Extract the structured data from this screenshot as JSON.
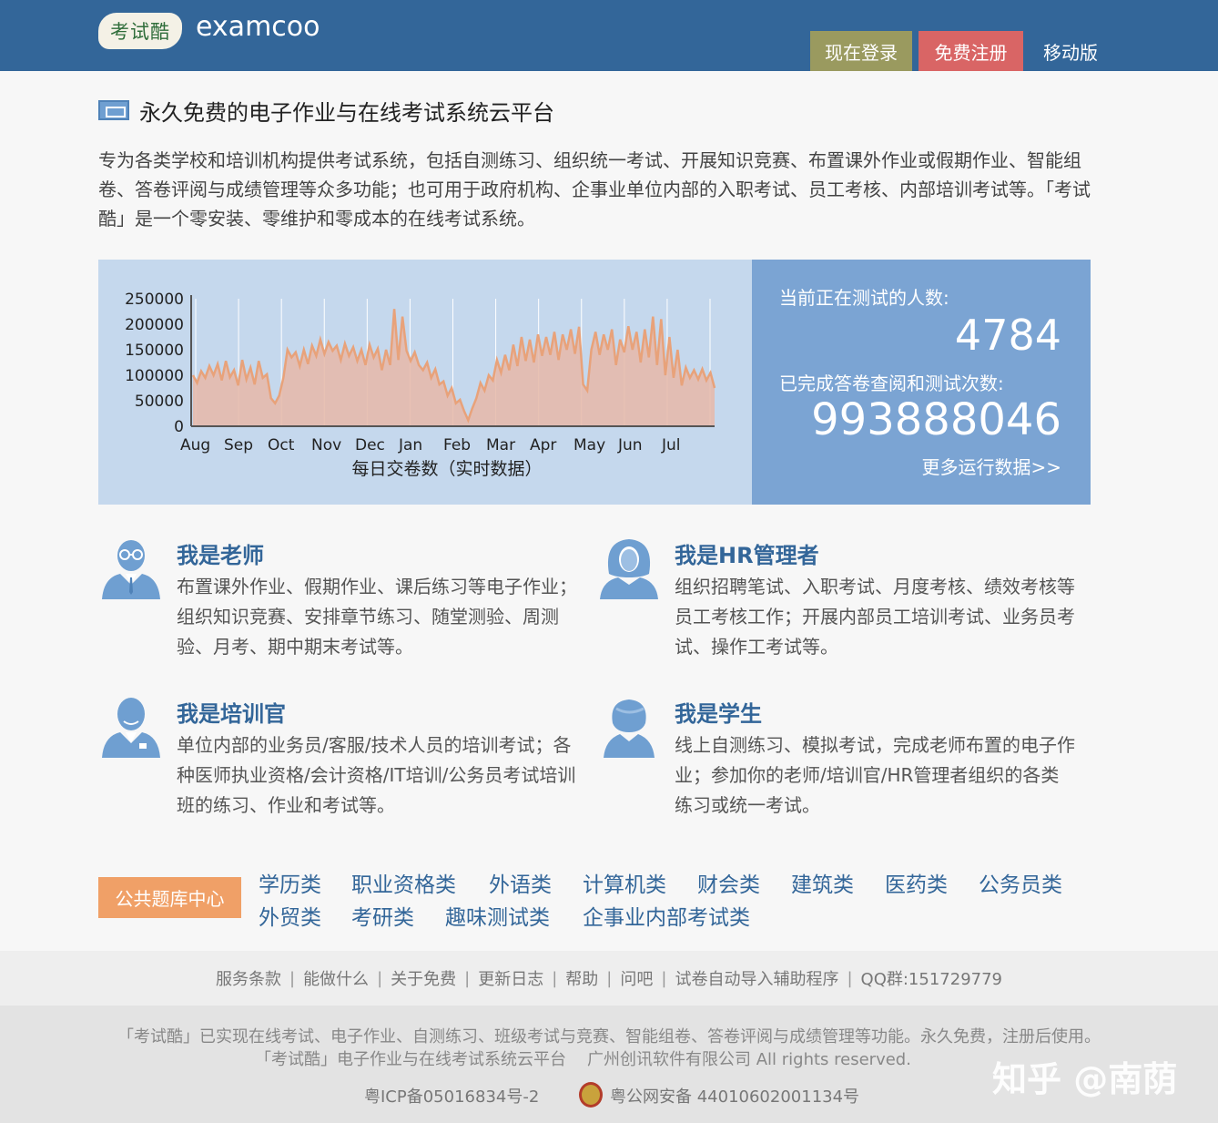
{
  "header": {
    "logo_mark": "考试酷",
    "logo_text": "examcoo",
    "login_label": "现在登录",
    "register_label": "免费注册",
    "mobile_label": "移动版"
  },
  "intro": {
    "title": "永久免费的电子作业与在线考试系统云平台",
    "description": "专为各类学校和培训机构提供考试系统，包括自测练习、组织统一考试、开展知识竞赛、布置课外作业或假期作业、智能组卷、答卷评阅与成绩管理等众多功能；也可用于政府机构、企事业单位内部的入职考试、员工考核、内部培训考试等。「考试酷」是一个零安装、零维护和零成本的在线考试系统。"
  },
  "stats": {
    "current_label": "当前正在测试的人数:",
    "current_value": "4784",
    "total_label": "已完成答卷查阅和测试次数:",
    "total_value": "993888046",
    "more_link": "更多运行数据>>"
  },
  "chart_data": {
    "type": "area",
    "title": "",
    "xlabel": "每日交卷数（实时数据）",
    "ylabel": "",
    "ylim": [
      0,
      250000
    ],
    "yticks": [
      "250000",
      "200000",
      "150000",
      "100000",
      "50000",
      "0"
    ],
    "categories": [
      "Aug",
      "Sep",
      "Oct",
      "Nov",
      "Dec",
      "Jan",
      "Feb",
      "Mar",
      "Apr",
      "May",
      "Jun",
      "Jul"
    ],
    "series": [
      {
        "values": [
          100000,
          85000,
          108000,
          95000,
          118000,
          100000,
          122000,
          90000,
          128000,
          96000,
          110000,
          80000,
          130000,
          92000,
          115000,
          82000,
          128000,
          95000,
          102000,
          55000,
          45000,
          60000,
          95000,
          150000,
          135000,
          145000,
          118000,
          150000,
          122000,
          158000,
          138000,
          170000,
          142000,
          165000,
          148000,
          158000,
          130000,
          162000,
          138000,
          155000,
          128000,
          150000,
          120000,
          160000,
          135000,
          152000,
          110000,
          150000,
          120000,
          230000,
          130000,
          215000,
          148000,
          128000,
          145000,
          120000,
          110000,
          125000,
          95000,
          112000,
          82000,
          88000,
          60000,
          75000,
          45000,
          52000,
          30000,
          12000,
          35000,
          55000,
          85000,
          70000,
          100000,
          90000,
          130000,
          105000,
          140000,
          110000,
          160000,
          118000,
          175000,
          128000,
          170000,
          125000,
          180000,
          138000,
          175000,
          140000,
          185000,
          130000,
          180000,
          150000,
          190000,
          142000,
          195000,
          82000,
          70000,
          150000,
          185000,
          140000,
          180000,
          150000,
          190000,
          120000,
          170000,
          145000,
          196000,
          150000,
          185000,
          125000,
          190000,
          135000,
          215000,
          120000,
          210000,
          100000,
          175000,
          95000,
          150000,
          80000,
          115000,
          95000,
          110000,
          92000,
          112000,
          90000,
          105000,
          75000
        ]
      }
    ]
  },
  "roles": [
    {
      "title": "我是老师",
      "desc": "布置课外作业、假期作业、课后练习等电子作业；组织知识竞赛、安排章节练习、随堂测验、周测验、月考、期中期末考试等。"
    },
    {
      "title": "我是HR管理者",
      "desc": "组织招聘笔试、入职考试、月度考核、绩效考核等员工考核工作；开展内部员工培训考试、业务员考试、操作工考试等。"
    },
    {
      "title": "我是培训官",
      "desc": "单位内部的业务员/客服/技术人员的培训考试；各种医师执业资格/会计资格/IT培训/公务员考试培训班的练习、作业和考试等。"
    },
    {
      "title": "我是学生",
      "desc": "线上自测练习、模拟考试，完成老师布置的电子作业；参加你的老师/培训官/HR管理者组织的各类练习或统一考试。"
    }
  ],
  "categories": {
    "badge": "公共题库中心",
    "row1": [
      "学历类",
      "职业资格类",
      "外语类",
      "计算机类",
      "财会类",
      "建筑类",
      "医药类",
      "公务员类"
    ],
    "row2": [
      "外贸类",
      "考研类",
      "趣味测试类",
      "企事业内部考试类"
    ]
  },
  "footer": {
    "links": [
      "服务条款",
      "能做什么",
      "关于免费",
      "更新日志",
      "帮助",
      "问吧",
      "试卷自动导入辅助程序",
      "QQ群:151729779"
    ],
    "line1": "「考试酷」已实现在线考试、电子作业、自测练习、班级考试与竞赛、智能组卷、答卷评阅与成绩管理等功能。永久免费，注册后使用。",
    "line2": "「考试酷」电子作业与在线考试系统云平台",
    "company": "广州创讯软件有限公司  All rights reserved.",
    "icp": "粤ICP备05016834号-2",
    "police": "粤公网安备 44010602001134号",
    "watermark": "知乎 @南荫"
  },
  "colors": {
    "header_bg": "#336699",
    "login_bg": "#9a9a5f",
    "register_bg": "#d96565",
    "chart_bg": "#c5d8ed",
    "stats_bg": "#7ba4d3",
    "series_line": "#e8a27a",
    "series_fill": "#e6b9a8",
    "badge_bg": "#f0a067",
    "link_color": "#336699"
  }
}
